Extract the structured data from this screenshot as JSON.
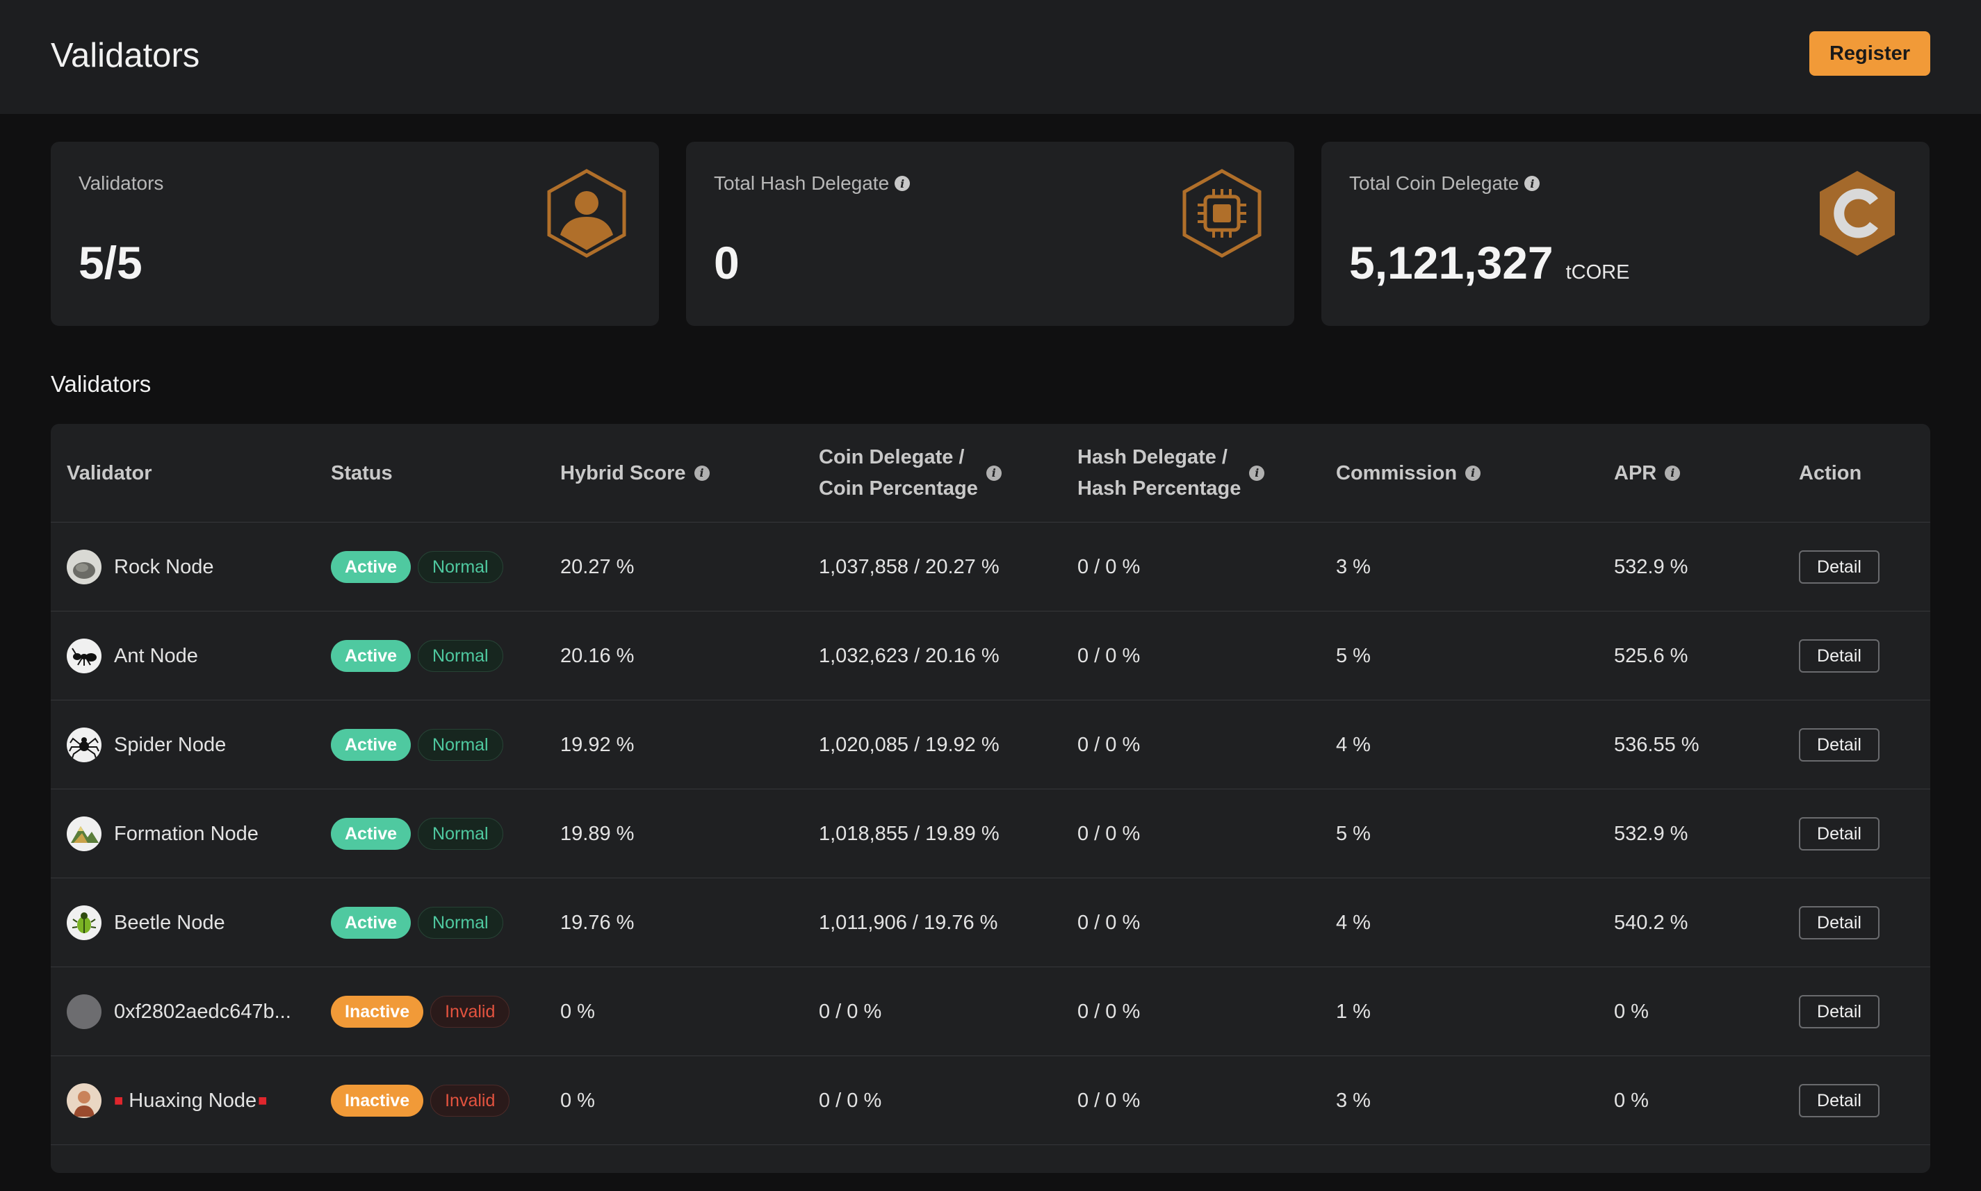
{
  "header": {
    "title": "Validators",
    "register_label": "Register"
  },
  "cards": [
    {
      "label": "Validators",
      "value": "5/5",
      "unit": "",
      "icon": "user-hexagon-icon",
      "has_info": false
    },
    {
      "label": "Total Hash Delegate",
      "value": "0",
      "unit": "",
      "icon": "chip-hexagon-icon",
      "has_info": true
    },
    {
      "label": "Total Coin Delegate",
      "value": "5,121,327",
      "unit": "tCORE",
      "icon": "core-coin-hexagon-icon",
      "has_info": true
    }
  ],
  "section_title": "Validators",
  "table": {
    "columns": {
      "validator": "Validator",
      "status": "Status",
      "hybrid_score": "Hybrid Score",
      "coin_delegate_1": "Coin Delegate /",
      "coin_delegate_2": "Coin Percentage",
      "hash_delegate_1": "Hash Delegate /",
      "hash_delegate_2": "Hash Percentage",
      "commission": "Commission",
      "apr": "APR",
      "action": "Action"
    },
    "rows": [
      {
        "name": "Rock Node",
        "avatar": "rock-avatar-icon",
        "status": "Active",
        "state": "Normal",
        "hybrid_score": "20.27 %",
        "coin": "1,037,858 / 20.27 %",
        "hash": "0 / 0 %",
        "commission": "3 %",
        "apr": "532.9 %",
        "action": "Detail"
      },
      {
        "name": "Ant Node",
        "avatar": "ant-avatar-icon",
        "status": "Active",
        "state": "Normal",
        "hybrid_score": "20.16 %",
        "coin": "1,032,623 / 20.16 %",
        "hash": "0 / 0 %",
        "commission": "5 %",
        "apr": "525.6 %",
        "action": "Detail"
      },
      {
        "name": "Spider Node",
        "avatar": "spider-avatar-icon",
        "status": "Active",
        "state": "Normal",
        "hybrid_score": "19.92 %",
        "coin": "1,020,085 / 19.92 %",
        "hash": "0 / 0 %",
        "commission": "4 %",
        "apr": "536.55 %",
        "action": "Detail"
      },
      {
        "name": "Formation Node",
        "avatar": "mountain-avatar-icon",
        "status": "Active",
        "state": "Normal",
        "hybrid_score": "19.89 %",
        "coin": "1,018,855 / 19.89 %",
        "hash": "0 / 0 %",
        "commission": "5 %",
        "apr": "532.9 %",
        "action": "Detail"
      },
      {
        "name": "Beetle Node",
        "avatar": "beetle-avatar-icon",
        "status": "Active",
        "state": "Normal",
        "hybrid_score": "19.76 %",
        "coin": "1,011,906 / 19.76 %",
        "hash": "0 / 0 %",
        "commission": "4 %",
        "apr": "540.2 %",
        "action": "Detail"
      },
      {
        "name": "0xf2802aedc647b...",
        "avatar": "placeholder-avatar-icon",
        "status": "Inactive",
        "state": "Invalid",
        "hybrid_score": "0 %",
        "coin": "0 / 0 %",
        "hash": "0 / 0 %",
        "commission": "1 %",
        "apr": "0 %",
        "action": "Detail"
      },
      {
        "name": "Huaxing Node",
        "avatar": "portrait-avatar-icon",
        "status": "Inactive",
        "state": "Invalid",
        "hybrid_score": "0 %",
        "coin": "0 / 0 %",
        "hash": "0 / 0 %",
        "commission": "3 %",
        "apr": "0 %",
        "action": "Detail"
      }
    ]
  },
  "colors": {
    "accent": "#f19a38",
    "active": "#4fc9a0",
    "invalid": "#e4533f",
    "icon_bronze": "#b06f2a"
  }
}
